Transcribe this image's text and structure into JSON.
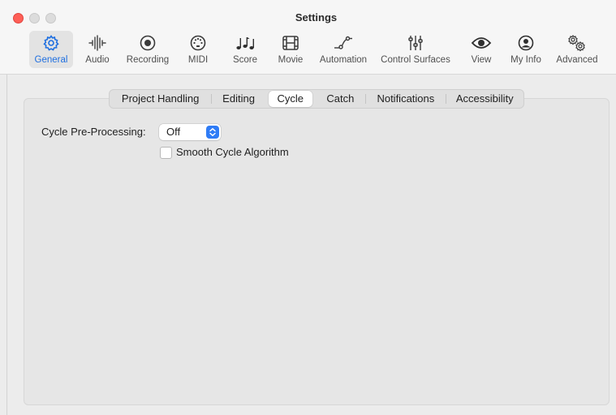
{
  "window": {
    "title": "Settings"
  },
  "toolbar": {
    "items": [
      {
        "label": "General",
        "icon": "gear-icon",
        "selected": true
      },
      {
        "label": "Audio",
        "icon": "waveform-icon"
      },
      {
        "label": "Recording",
        "icon": "record-icon"
      },
      {
        "label": "MIDI",
        "icon": "midi-icon"
      },
      {
        "label": "Score",
        "icon": "music-notes-icon"
      },
      {
        "label": "Movie",
        "icon": "film-icon"
      },
      {
        "label": "Automation",
        "icon": "automation-curve-icon"
      },
      {
        "label": "Control Surfaces",
        "icon": "sliders-icon"
      },
      {
        "label": "View",
        "icon": "eye-icon"
      },
      {
        "label": "My Info",
        "icon": "person-icon"
      },
      {
        "label": "Advanced",
        "icon": "gears-icon"
      }
    ],
    "accent_color": "#1f6fe0"
  },
  "tabs": [
    {
      "label": "Project Handling"
    },
    {
      "label": "Editing"
    },
    {
      "label": "Cycle",
      "selected": true
    },
    {
      "label": "Catch"
    },
    {
      "label": "Notifications"
    },
    {
      "label": "Accessibility"
    }
  ],
  "cycle": {
    "preprocessing_label": "Cycle Pre-Processing:",
    "preprocessing_value": "Off",
    "smooth_label": "Smooth Cycle Algorithm",
    "smooth_checked": false
  },
  "colors": {
    "close_button": "#fe5f57",
    "select_accent": "#2f7cf6"
  }
}
